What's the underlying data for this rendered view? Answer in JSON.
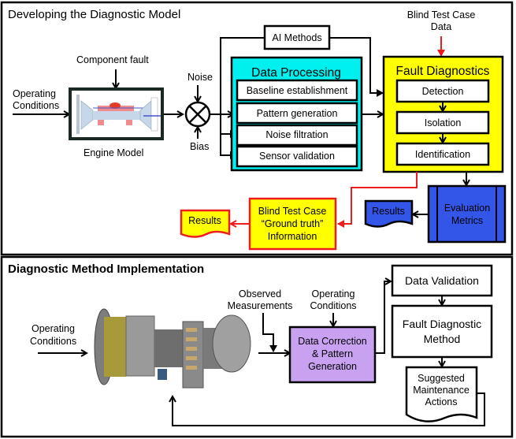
{
  "colors": {
    "data_processing_fill": "#00f0f0",
    "fault_diagnostics_fill": "#ffff00",
    "evaluation_fill": "#3355e8",
    "blind_test_fill": "#ffff00",
    "blind_test_stroke": "#ee1c1c",
    "correction_fill": "#c8a2f0",
    "red_arrow": "#ee1c1c"
  },
  "top": {
    "title": "Developing the Diagnostic Model",
    "operating_conditions": [
      "Operating",
      "Conditions"
    ],
    "component_fault": "Component fault",
    "engine_model": "Engine Model",
    "noise": "Noise",
    "bias": "Bias",
    "ai_methods": "AI Methods",
    "data_processing": {
      "title": "Data Processing",
      "items": [
        "Baseline establishment",
        "Pattern generation",
        "Noise filtration",
        "Sensor validation"
      ]
    },
    "blind_test_data": [
      "Blind Test Case",
      "Data"
    ],
    "fault_diagnostics": {
      "title": "Fault Diagnostics",
      "items": [
        "Detection",
        "Isolation",
        "Identification"
      ]
    },
    "evaluation_metrics": [
      "Evaluation",
      "Metrics"
    ],
    "results_blue": "Results",
    "blind_test_truth": [
      "Blind Test Case",
      "“Ground truth”",
      "Information"
    ],
    "results_yellow": "Results"
  },
  "bottom": {
    "title": "Diagnostic Method Implementation",
    "operating_conditions_left": [
      "Operating",
      "Conditions"
    ],
    "observed_measurements": [
      "Observed",
      "Measurements"
    ],
    "operating_conditions_mid": [
      "Operating",
      "Conditions"
    ],
    "data_correction": [
      "Data Correction",
      "& Pattern",
      "Generation"
    ],
    "data_validation": "Data Validation",
    "fault_diagnostic_method": [
      "Fault Diagnostic",
      "Method"
    ],
    "suggested_actions": [
      "Suggested",
      "Maintenance",
      "Actions"
    ],
    "engine_image": "gas-turbine-engine-photo"
  }
}
